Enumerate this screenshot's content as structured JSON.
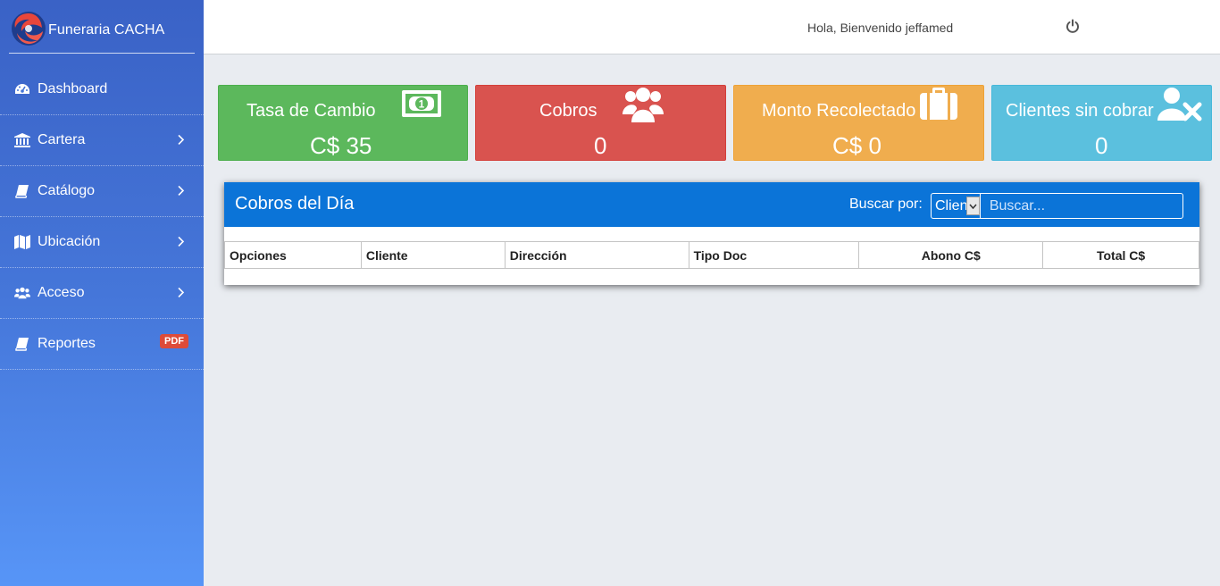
{
  "sidebar": {
    "brand": "Funeraria CACHA",
    "items": [
      {
        "label": "Dashboard",
        "icon": "tachometer-icon",
        "chevron": false
      },
      {
        "label": "Cartera",
        "icon": "bank-icon",
        "chevron": true
      },
      {
        "label": "Catálogo",
        "icon": "book-icon",
        "chevron": true
      },
      {
        "label": "Ubicación",
        "icon": "map-icon",
        "chevron": true
      },
      {
        "label": "Acceso",
        "icon": "users-icon",
        "chevron": true
      },
      {
        "label": "Reportes",
        "icon": "book-icon",
        "chevron": false,
        "badge": "PDF"
      }
    ]
  },
  "header": {
    "welcome": "Hola, Bienvenido jeffamed",
    "power_icon": "power-icon"
  },
  "cards": [
    {
      "title": "Tasa de Cambio",
      "value": "C$ 35",
      "icon": "money-icon",
      "color": "#5cb85c"
    },
    {
      "title": "Cobros",
      "value": "0",
      "icon": "users-icon",
      "color": "#d9534f"
    },
    {
      "title": "Monto Recolectado",
      "value": "C$ 0",
      "icon": "briefcase-icon",
      "color": "#f0ad4e"
    },
    {
      "title": "Clientes sin cobrar",
      "value": "0",
      "icon": "user-times-icon",
      "color": "#5bc0de"
    }
  ],
  "panel": {
    "title": "Cobros del Día",
    "search_label": "Buscar por:",
    "search_select": "Cliente",
    "search_placeholder": "Buscar...",
    "columns": [
      "Opciones",
      "Cliente",
      "Dirección",
      "Tipo Doc",
      "Abono C$",
      "Total C$"
    ],
    "rows": []
  },
  "colors": {
    "panel_header": "#0b74d8",
    "sidebar_top": "#3a62c6",
    "sidebar_bottom": "#5795f7",
    "badge": "#dd4b39"
  }
}
